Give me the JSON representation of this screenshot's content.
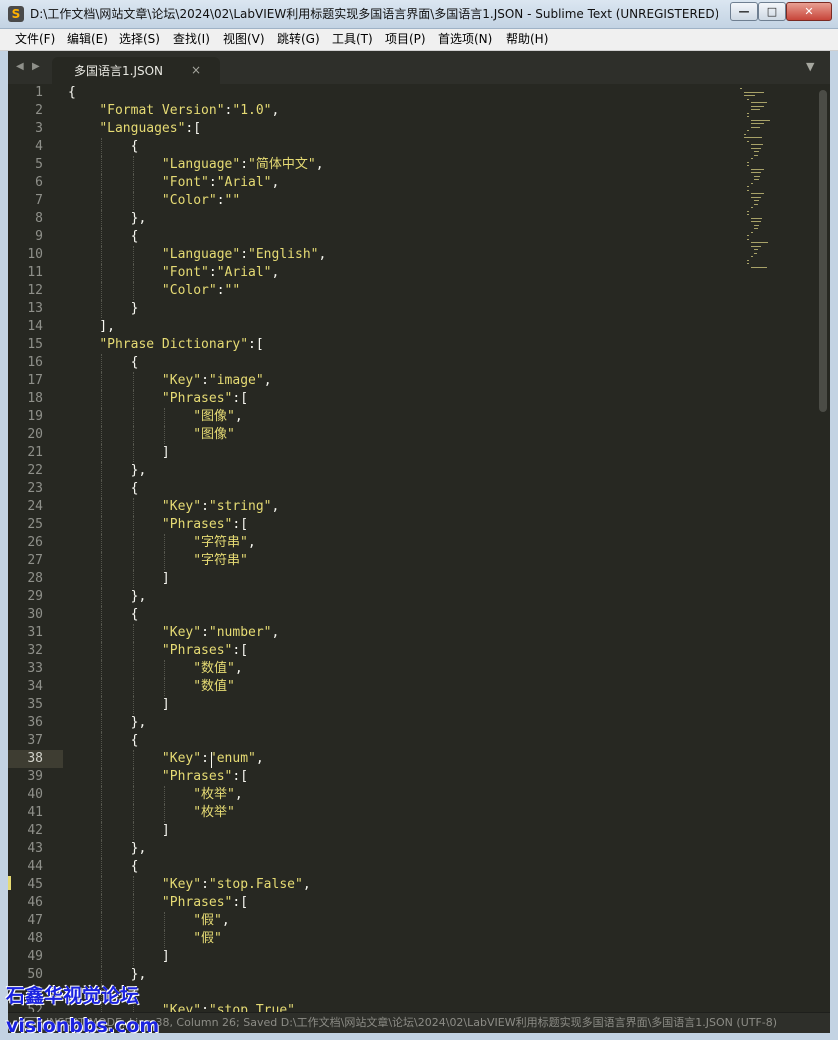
{
  "window": {
    "title": "D:\\工作文档\\网站文章\\论坛\\2024\\02\\LabVIEW利用标题实现多国语言界面\\多国语言1.JSON - Sublime Text (UNREGISTERED)",
    "app_icon": "S",
    "minimize_glyph": "—",
    "maximize_glyph": "□",
    "close_glyph": "✕"
  },
  "menu": {
    "items": [
      {
        "label": "文件(F)"
      },
      {
        "label": "编辑(E)"
      },
      {
        "label": "选择(S)"
      },
      {
        "label": "查找(I)"
      },
      {
        "label": "视图(V)"
      },
      {
        "label": "跳转(G)"
      },
      {
        "label": "工具(T)"
      },
      {
        "label": "项目(P)"
      },
      {
        "label": "首选项(N)"
      },
      {
        "label": "帮助(H)"
      }
    ]
  },
  "tabs": {
    "nav_left": "◀",
    "nav_right": "▶",
    "active_label": "多国语言1.JSON",
    "close_glyph": "×",
    "menu_glyph": "▼"
  },
  "editor": {
    "current_line": 38,
    "lines": [
      "{",
      "    \"Format Version\":\"1.0\",",
      "    \"Languages\":[",
      "        {",
      "            \"Language\":\"简体中文\",",
      "            \"Font\":\"Arial\",",
      "            \"Color\":\"\"",
      "        },",
      "        {",
      "            \"Language\":\"English\",",
      "            \"Font\":\"Arial\",",
      "            \"Color\":\"\"",
      "        }",
      "    ],",
      "    \"Phrase Dictionary\":[",
      "        {",
      "            \"Key\":\"image\",",
      "            \"Phrases\":[",
      "                \"图像\",",
      "                \"图像\"",
      "            ]",
      "        },",
      "        {",
      "            \"Key\":\"string\",",
      "            \"Phrases\":[",
      "                \"字符串\",",
      "                \"字符串\"",
      "            ]",
      "        },",
      "        {",
      "            \"Key\":\"number\",",
      "            \"Phrases\":[",
      "                \"数值\",",
      "                \"数值\"",
      "            ]",
      "        },",
      "        {",
      "            \"Key\":\"enum\",",
      "            \"Phrases\":[",
      "                \"枚举\",",
      "                \"枚举\"",
      "            ]",
      "        },",
      "        {",
      "            \"Key\":\"stop.False\",",
      "            \"Phrases\":[",
      "                \"假\",",
      "                \"假\"",
      "            ]",
      "        },",
      "        {",
      "            \"Key\":\"stop.True\","
    ]
  },
  "status": {
    "text": "INSERT MODE, Line 38, Column 26; Saved D:\\工作文档\\网站文章\\论坛\\2024\\02\\LabVIEW利用标题实现多国语言界面\\多国语言1.JSON (UTF-8)"
  },
  "watermark": {
    "line1": "石鑫华视觉论坛",
    "line2": "visionbbs.com"
  }
}
